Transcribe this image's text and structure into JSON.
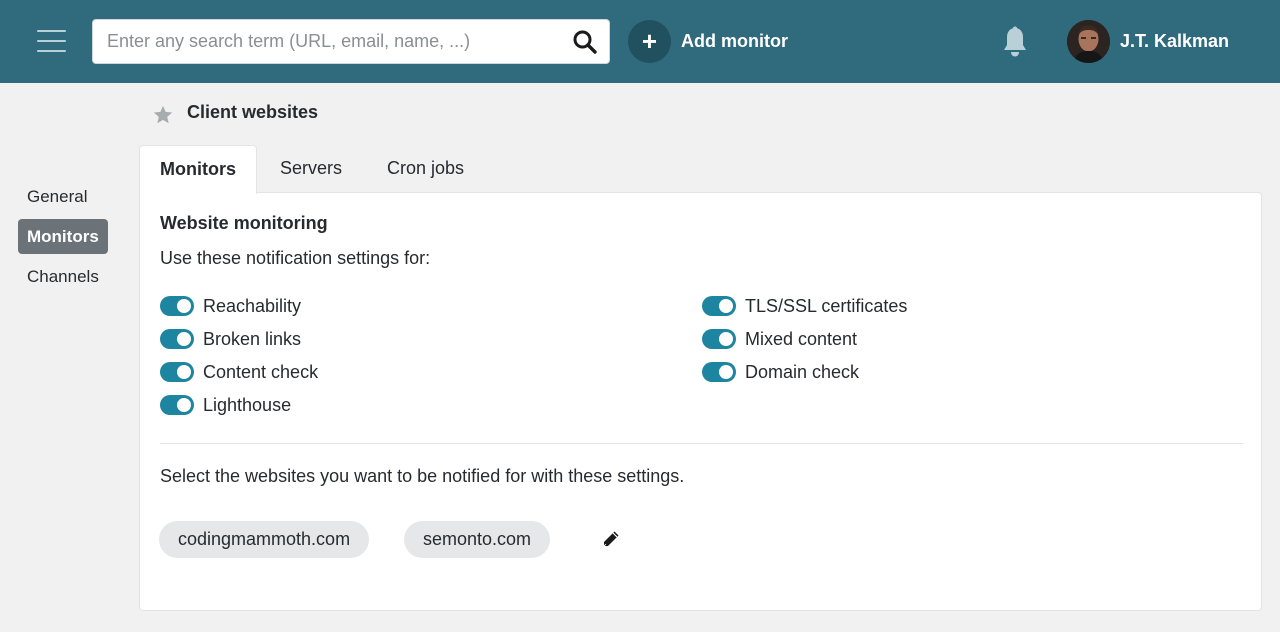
{
  "header": {
    "search_placeholder": "Enter any search term (URL, email, name, ...)",
    "add_monitor_label": "Add monitor",
    "add_symbol": "+",
    "user_name": "J.T. Kalkman"
  },
  "page": {
    "title": "Client websites"
  },
  "sidebar": {
    "items": [
      {
        "label": "General",
        "active": false
      },
      {
        "label": "Monitors",
        "active": true
      },
      {
        "label": "Channels",
        "active": false
      }
    ]
  },
  "tabs": [
    {
      "label": "Monitors",
      "active": true
    },
    {
      "label": "Servers",
      "active": false
    },
    {
      "label": "Cron jobs",
      "active": false
    }
  ],
  "settings": {
    "section_title": "Website monitoring",
    "intro": "Use these notification settings for:",
    "toggles": [
      {
        "label": "Reachability",
        "enabled": true
      },
      {
        "label": "Broken links",
        "enabled": true
      },
      {
        "label": "Content check",
        "enabled": true
      },
      {
        "label": "Lighthouse",
        "enabled": true
      },
      {
        "label": "TLS/SSL certificates",
        "enabled": true
      },
      {
        "label": "Mixed content",
        "enabled": true
      },
      {
        "label": "Domain check",
        "enabled": true
      }
    ],
    "select_text": "Select the websites you want to be notified for with these settings.",
    "websites": [
      "codingmammoth.com",
      "semonto.com"
    ]
  },
  "icons": {
    "menu": "hamburger-icon",
    "search": "search-icon",
    "bell": "bell-icon",
    "star": "star-icon",
    "edit": "pencil-icon"
  },
  "colors": {
    "topbar": "#306a7d",
    "add_circle": "#21505f",
    "toggle_on": "#1e85a1",
    "sidebar_active": "#6b7278",
    "chip_bg": "#e6e7e8"
  }
}
